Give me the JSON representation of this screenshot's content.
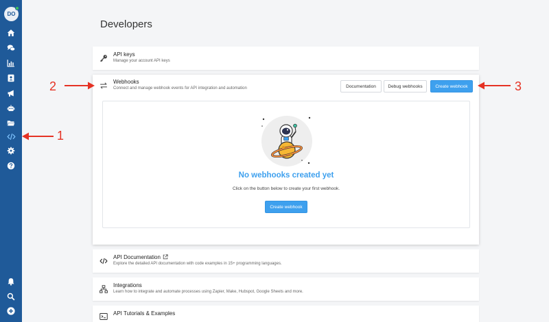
{
  "sidebar": {
    "avatar_initials": "DO",
    "status_color": "#3ec45c",
    "background": "#1f5a99",
    "items": [
      {
        "name": "home-icon"
      },
      {
        "name": "chat-icon"
      },
      {
        "name": "bar-chart-icon"
      },
      {
        "name": "contacts-icon"
      },
      {
        "name": "megaphone-icon"
      },
      {
        "name": "bot-icon"
      },
      {
        "name": "folder-icon"
      },
      {
        "name": "code-icon",
        "active": true
      },
      {
        "name": "gear-icon"
      },
      {
        "name": "help-icon"
      }
    ],
    "bottom_items": [
      {
        "name": "bell-icon"
      },
      {
        "name": "search-icon"
      },
      {
        "name": "plus-circle-icon"
      }
    ]
  },
  "page": {
    "title": "Developers"
  },
  "api_keys": {
    "title": "API keys",
    "description": "Manage your account API keys",
    "icon": "key-icon"
  },
  "webhooks": {
    "title": "Webhooks",
    "description": "Connect and manage webhook events for API integration and automation",
    "icon": "swap-arrows-icon",
    "buttons": {
      "documentation": "Documentation",
      "debug": "Debug webhooks",
      "create": "Create webhook"
    },
    "empty_state": {
      "title": "No webhooks created yet",
      "description": "Click on the button below to create your first webhook.",
      "button": "Create webhook"
    }
  },
  "api_documentation": {
    "title": "API Documentation",
    "description": "Explore the detailed API documentation with code examples in 15+ programming languages.",
    "icon": "code-icon"
  },
  "integrations": {
    "title": "Integrations",
    "description": "Learn how to integrate and automate processes using Zapier, Make, Hubspot, Google Sheets and more.",
    "icon": "sitemap-icon"
  },
  "api_tutorials": {
    "title": "API Tutorials & Examples",
    "icon": "terminal-icon"
  },
  "annotations": [
    {
      "label": "1"
    },
    {
      "label": "2"
    },
    {
      "label": "3"
    }
  ],
  "colors": {
    "accent": "#3ea0ee",
    "annotation": "#e53224",
    "page_bg": "#f4f5f7"
  }
}
